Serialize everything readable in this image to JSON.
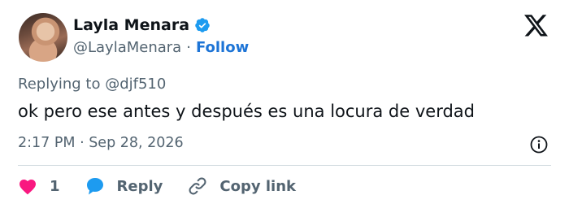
{
  "author": {
    "name": "Layla Menara",
    "handle": "@LaylaMenara",
    "separator": "·",
    "follow_label": "Follow"
  },
  "tweet": {
    "replying_to": "Replying to @djf510",
    "text": "ok pero ese antes y después es una locura de verdad",
    "timestamp": "2:17 PM · Sep 28, 2026"
  },
  "actions": {
    "like_count": "1",
    "reply_label": "Reply",
    "copy_label": "Copy link"
  },
  "icons": {
    "verified": "verified-badge-icon",
    "platform": "x-logo-icon",
    "info": "info-icon",
    "like": "heart-icon",
    "reply": "speech-bubble-icon",
    "copy": "link-icon"
  },
  "colors": {
    "accent_blue": "#1d74d6",
    "verified_blue": "#1d9bf0",
    "like_red": "#f91880",
    "reply_blue": "#1d9bf0",
    "secondary_text": "#536471"
  }
}
